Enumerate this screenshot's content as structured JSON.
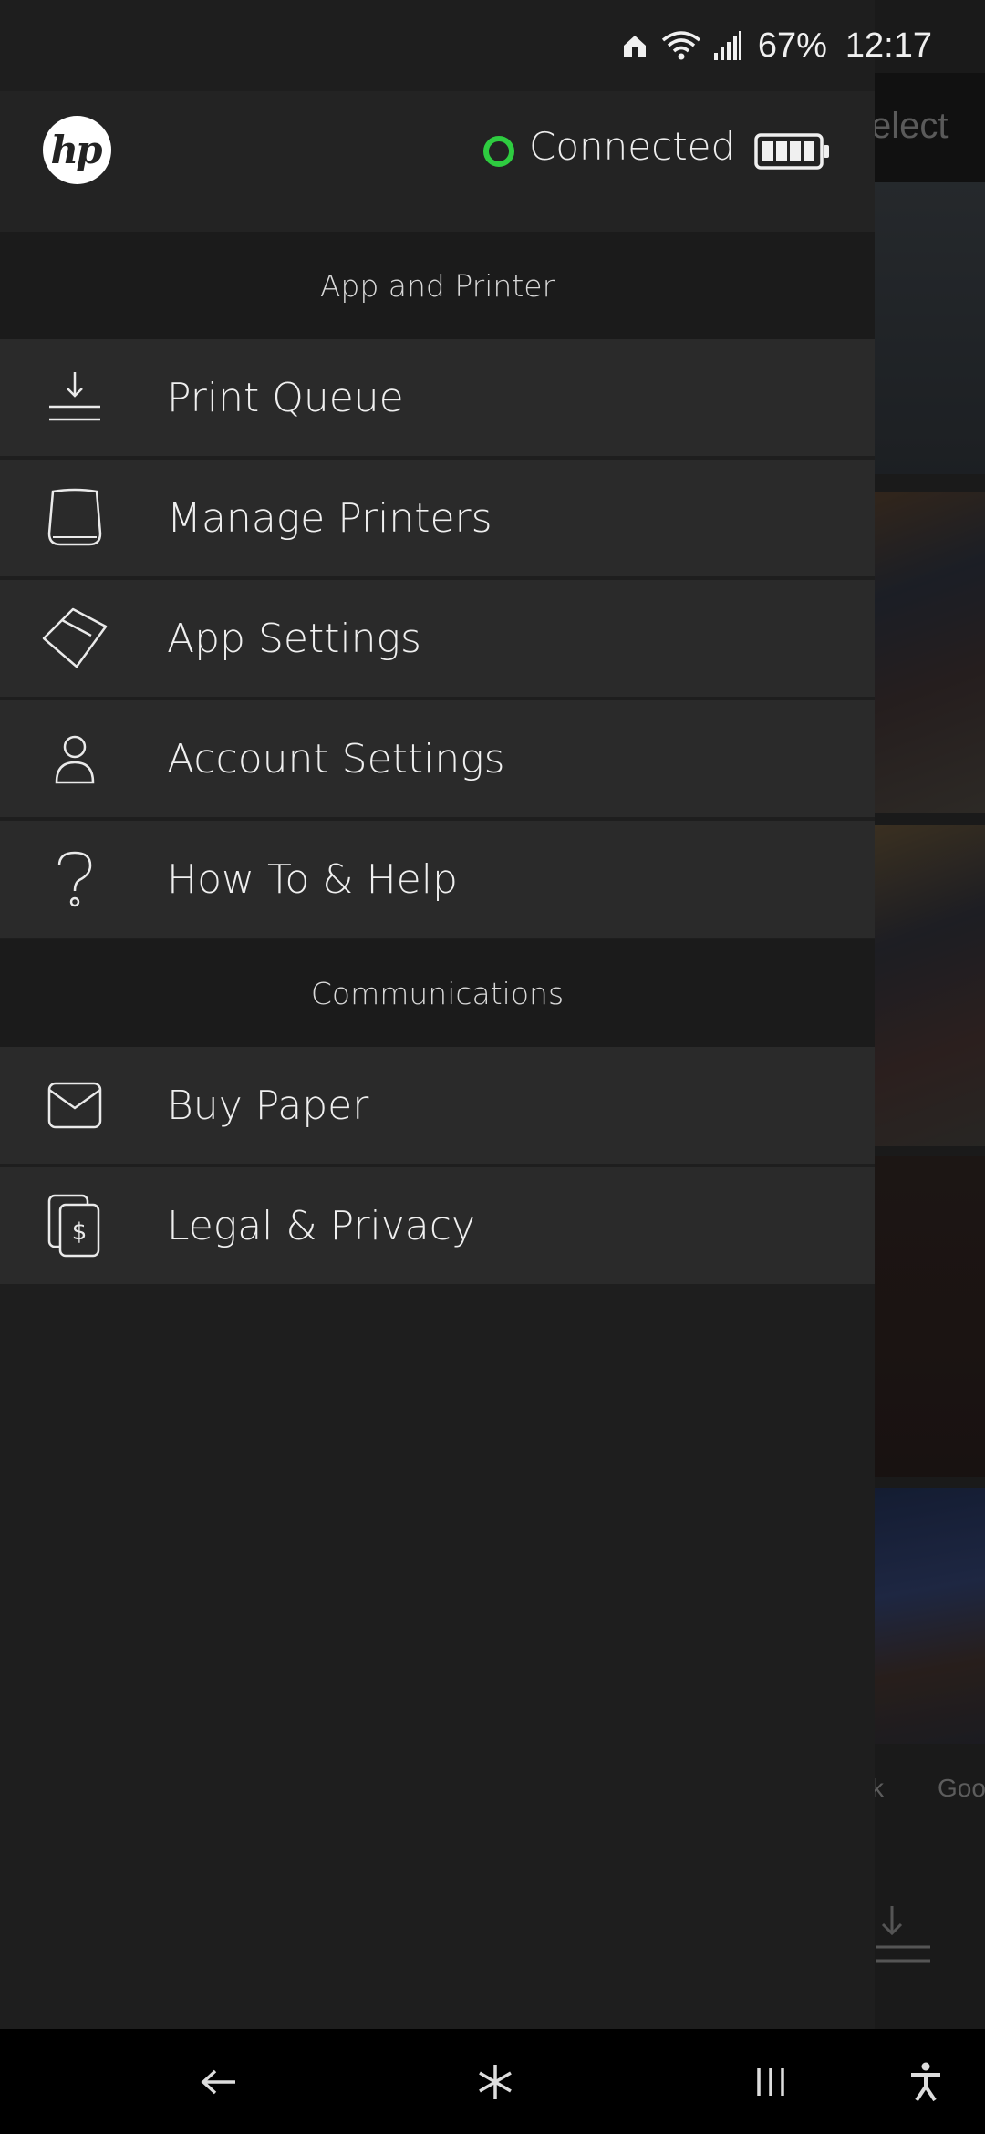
{
  "status_bar": {
    "battery_percent": "67%",
    "time": "12:17"
  },
  "background_app": {
    "select_label": "elect",
    "bottom_labels": [
      "k",
      "Goo"
    ]
  },
  "drawer": {
    "brand": "hp",
    "connection_status": "Connected",
    "connection_color": "#2ecc40",
    "sections": [
      {
        "title": "App and Printer",
        "items": [
          {
            "label": "Print Queue",
            "icon": "download-tray-icon"
          },
          {
            "label": "Manage Printers",
            "icon": "printer-icon"
          },
          {
            "label": "App Settings",
            "icon": "settings-tag-icon"
          },
          {
            "label": "Account Settings",
            "icon": "person-icon"
          },
          {
            "label": "How To & Help",
            "icon": "question-icon"
          }
        ]
      },
      {
        "title": "Communications",
        "items": [
          {
            "label": "Buy Paper",
            "icon": "envelope-icon"
          },
          {
            "label": "Legal & Privacy",
            "icon": "legal-document-icon"
          }
        ]
      }
    ]
  }
}
